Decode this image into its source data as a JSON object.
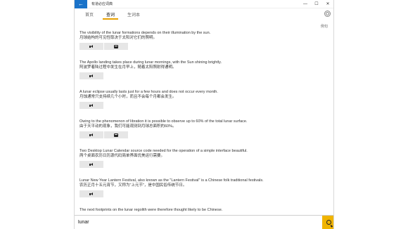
{
  "app": {
    "title": "有道必应词典"
  },
  "window_controls": {
    "minimize": "—",
    "maximize": "☐",
    "close": "✕"
  },
  "tabs": [
    {
      "label": "首页"
    },
    {
      "label": "查词"
    },
    {
      "label": "生词本"
    }
  ],
  "examples_label": "例句",
  "entries": [
    {
      "en": "The visibility of the lunar formations depends on their illumination by the sun.",
      "zh": "月球结构的可见性取决于太阳对它们的照明。",
      "buttons": [
        "speaker",
        "book"
      ]
    },
    {
      "en": "The Apollo landing takes place during lunar mornings, with the Sun shining brightly.",
      "zh": "阿波罗着陆过程中发生在月早上，随着太阳照射得通明。",
      "buttons": [
        "speaker"
      ]
    },
    {
      "en": "A lunar eclipse usually lasts just for a few hours and does not occur every month.",
      "zh": "月蚀通常只支持续几个小时，而且不会每个月都会发生。",
      "buttons": [
        "speaker"
      ]
    },
    {
      "en": "Owing to the phenomenon of libration it is possible to observe up to 60% of the total lunar surface.",
      "zh": "由于天平动的现象，我们可能观测到月球总面积的60%。",
      "buttons": [
        "speaker",
        "book"
      ]
    },
    {
      "en": "Two Desktop Lunar Calendar source code needed for the operation of a simple interface beautiful.",
      "zh": "两个桌面农历日历源代码简单界面优美运行需要。",
      "buttons": [
        "speaker"
      ]
    },
    {
      "en": "Lunar New Year Lantern Festival, also known as the \"Lantern Festival\" is a Chinese folk traditional festivals.",
      "zh": "农历正月十五元宵节，又称为\"上元节\"，是中国民俗传统节日。",
      "buttons": [
        "speaker"
      ]
    },
    {
      "en": "The next footprints on the lunar regolith were therefore thought likely to be Chinese.",
      "zh": "",
      "buttons": []
    }
  ],
  "search": {
    "value": "lunar"
  }
}
